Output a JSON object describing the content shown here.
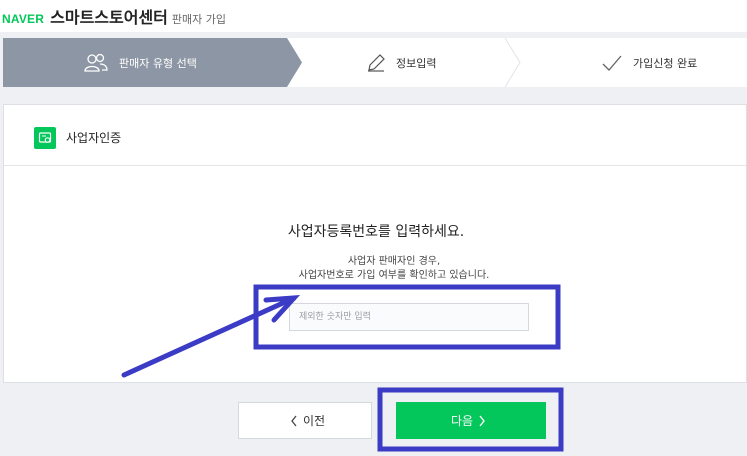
{
  "header": {
    "naver_logo": "NAVER",
    "service_name": "스마트스토어센터",
    "subtitle": "판매자 가입"
  },
  "steps": [
    {
      "label": "판매자 유형 선택",
      "icon": "people-icon",
      "active": true
    },
    {
      "label": "정보입력",
      "icon": "pencil-icon",
      "active": false
    },
    {
      "label": "가입신청 완료",
      "icon": "check-icon",
      "active": false
    }
  ],
  "card": {
    "title": "사업자인증",
    "icon": "certificate-icon",
    "prompt": "사업자등록번호를 입력하세요.",
    "description_line1": "사업자 판매자인 경우,",
    "description_line2": "사업자번호로 가입 여부를 확인하고 있습니다.",
    "input": {
      "value": "",
      "placeholder": "제외한 숫자만 입력"
    }
  },
  "buttons": {
    "prev_label": "이전",
    "next_label": "다음"
  },
  "colors": {
    "brand_green": "#03c75a",
    "active_step_bg": "#8d96a4",
    "annotation_blue": "#3b3bc6"
  }
}
